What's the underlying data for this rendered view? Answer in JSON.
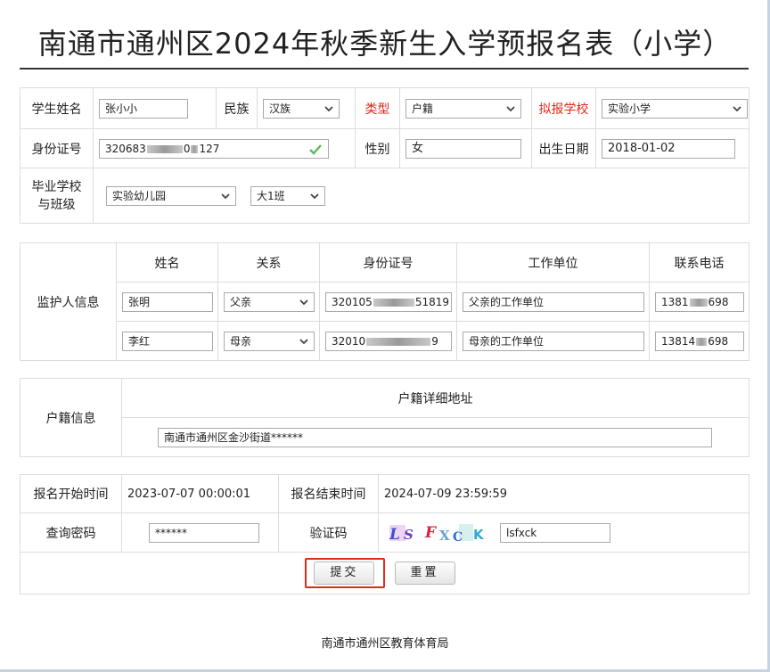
{
  "page_title": "南通市通州区2024年秋季新生入学预报名表（小学）",
  "student": {
    "name_label": "学生姓名",
    "name_value": "张小小",
    "ethnicity_label": "民族",
    "ethnicity_value": "汉族",
    "type_label": "类型",
    "type_value": "户籍",
    "school_label": "拟报学校",
    "school_value": "实验小学",
    "id_label": "身份证号",
    "id_prefix": "320683",
    "id_mid": "0",
    "id_suffix": "127",
    "gender_label": "性别",
    "gender_value": "女",
    "birth_label": "出生日期",
    "birth_value": "2018-01-02",
    "grad_label_1": "毕业学校",
    "grad_label_2": "与班级",
    "grad_school_value": "实验幼儿园",
    "grad_class_value": "大1班"
  },
  "guardian": {
    "section_label": "监护人信息",
    "headers": [
      "姓名",
      "关系",
      "身份证号",
      "工作单位",
      "联系电话"
    ],
    "rows": [
      {
        "name": "张明",
        "relation": "父亲",
        "id_prefix": "320105",
        "id_suffix": "51819",
        "work": "父亲的工作单位",
        "phone_prefix": "1381",
        "phone_suffix": "698"
      },
      {
        "name": "李红",
        "relation": "母亲",
        "id_prefix": "32010",
        "id_suffix": "9",
        "work": "母亲的工作单位",
        "phone_prefix": "13814",
        "phone_suffix": "698"
      }
    ]
  },
  "household": {
    "section_label": "户籍信息",
    "address_header": "户籍详细地址",
    "address_value": "南通市通州区金沙街道******"
  },
  "registration": {
    "start_label": "报名开始时间",
    "start_value": "2023-07-07 00:00:01",
    "end_label": "报名结束时间",
    "end_value": "2024-07-09 23:59:59",
    "password_label": "查询密码",
    "password_value": "******",
    "captcha_label": "验证码",
    "captcha_text": "LS FXCK",
    "captcha_input": "lsfxck",
    "submit_label": "提交",
    "reset_label": "重置"
  },
  "footer": "南通市通州区教育体育局",
  "colors": {
    "required_label": "#e0271c",
    "highlight_ring": "#e02a1f",
    "valid_check": "#5cb85c"
  },
  "icons": {
    "select_arrow": "chevron-down-icon",
    "valid": "check-icon"
  }
}
